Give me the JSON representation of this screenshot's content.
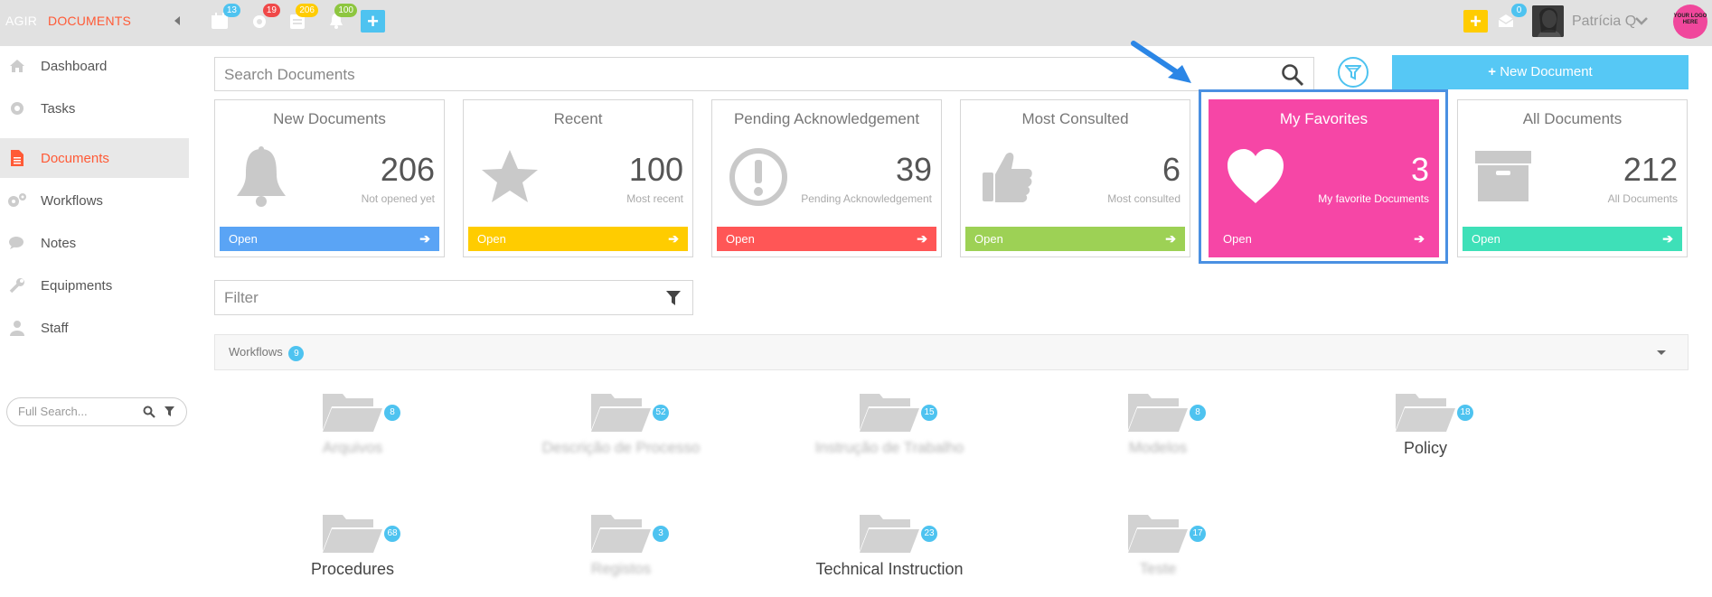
{
  "topbar": {
    "brand_left": "AGIR",
    "brand_right": "DOCUMENTS",
    "badges": {
      "calendar": "13",
      "settings": "19",
      "documents": "206",
      "notifications": "100",
      "messages": "0"
    },
    "user_name": "Patrícia Q",
    "logo_text": "YOUR LOGO HERE"
  },
  "sidebar": {
    "items": [
      {
        "label": "Dashboard",
        "icon": "home-icon"
      },
      {
        "label": "Tasks",
        "icon": "gear-icon"
      },
      {
        "label": "Documents",
        "icon": "document-icon",
        "active": true
      },
      {
        "label": "Workflows",
        "icon": "gears-icon"
      },
      {
        "label": "Notes",
        "icon": "chat-icon"
      },
      {
        "label": "Equipments",
        "icon": "wrench-icon"
      },
      {
        "label": "Staff",
        "icon": "user-icon"
      }
    ],
    "full_search_placeholder": "Full Search..."
  },
  "main": {
    "search_placeholder": "Search Documents",
    "new_document_label": "New Document",
    "cards": [
      {
        "title": "New Documents",
        "count": "206",
        "subtitle": "Not opened yet",
        "open": "Open",
        "color": "#5aa4f5",
        "icon": "bell-icon"
      },
      {
        "title": "Recent",
        "count": "100",
        "subtitle": "Most recent",
        "open": "Open",
        "color": "#ffcc00",
        "icon": "star-icon"
      },
      {
        "title": "Pending Acknowledgement",
        "count": "39",
        "subtitle": "Pending Acknowledgement",
        "open": "Open",
        "color": "#ff5656",
        "icon": "exclamation-icon"
      },
      {
        "title": "Most Consulted",
        "count": "6",
        "subtitle": "Most consulted",
        "open": "Open",
        "color": "#9dd155",
        "icon": "thumbs-up-icon"
      },
      {
        "title": "My Favorites",
        "count": "3",
        "subtitle": "My favorite Documents",
        "open": "Open",
        "color": "#f646a6",
        "icon": "heart-icon"
      },
      {
        "title": "All Documents",
        "count": "212",
        "subtitle": "All Documents",
        "open": "Open",
        "color": "#3ee0b8",
        "icon": "archive-icon"
      }
    ],
    "filter_placeholder": "Filter",
    "workflows_label": "Workflows",
    "workflows_count": "9",
    "folders": [
      {
        "label": "Arquivos",
        "count": "8",
        "blurred": true
      },
      {
        "label": "Descrição de Processo",
        "count": "52",
        "blurred": true
      },
      {
        "label": "Instrução de Trabalho",
        "count": "15",
        "blurred": true
      },
      {
        "label": "Modelos",
        "count": "8",
        "blurred": true
      },
      {
        "label": "Policy",
        "count": "18",
        "blurred": false
      },
      {
        "label": "Procedures",
        "count": "68",
        "blurred": false
      },
      {
        "label": "Registos",
        "count": "3",
        "blurred": true
      },
      {
        "label": "Technical Instruction",
        "count": "23",
        "blurred": false
      },
      {
        "label": "Teste",
        "count": "17",
        "blurred": true
      }
    ]
  }
}
